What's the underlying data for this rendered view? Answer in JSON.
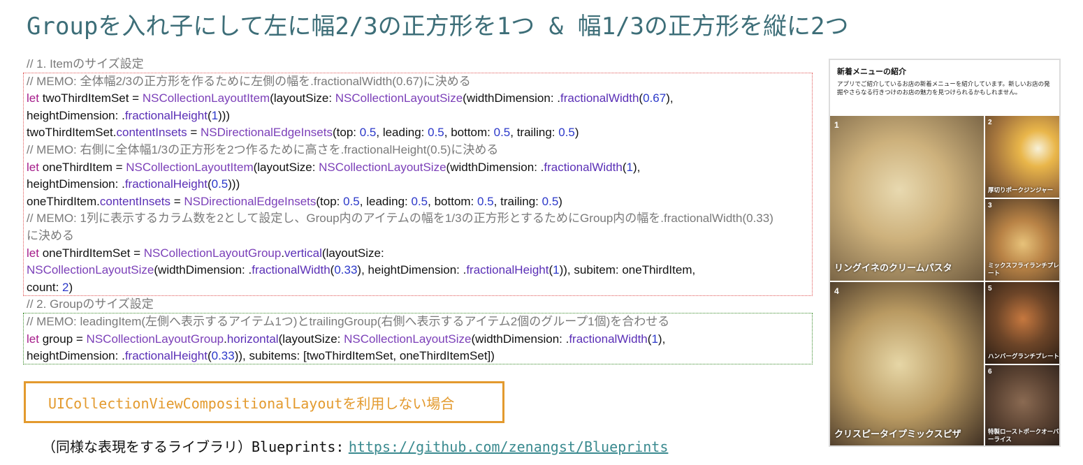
{
  "title": "Groupを入れ子にして左に幅2/3の正方形を1つ & 幅1/3の正方形を縦に2つ",
  "code": {
    "c1": "// 1. Itemのサイズ設定",
    "c2": "// MEMO: 全体幅2/3の正方形を作るために左側の幅を.fractionalWidth(0.67)に決める",
    "l3": {
      "kw": "let",
      "a": " twoThirdItemSet = ",
      "cls1": "NSCollectionLayoutItem",
      "b": "(layoutSize: ",
      "cls2": "NSCollectionLayoutSize",
      "c": "(widthDimension: .",
      "p": "fractionalWidth",
      "d": "(",
      "n": "0.67",
      "e": "),"
    },
    "l4": {
      "a": "heightDimension: .",
      "p": "fractionalHeight",
      "b": "(",
      "n": "1",
      "c": ")))"
    },
    "l5": {
      "a": "twoThirdItemSet.",
      "p1": "contentInsets",
      "b": " = ",
      "cls": "NSDirectionalEdgeInsets",
      "c": "(top: ",
      "n1": "0.5",
      "d": ", leading: ",
      "n2": "0.5",
      "e": ", bottom: ",
      "n3": "0.5",
      "f": ", trailing: ",
      "n4": "0.5",
      "g": ")"
    },
    "c6": "// MEMO: 右側に全体幅1/3の正方形を2つ作るために高さを.fractionalHeight(0.5)に決める",
    "l7": {
      "kw": "let",
      "a": " oneThirdItem = ",
      "cls1": "NSCollectionLayoutItem",
      "b": "(layoutSize: ",
      "cls2": "NSCollectionLayoutSize",
      "c": "(widthDimension: .",
      "p": "fractionalWidth",
      "d": "(",
      "n": "1",
      "e": "),"
    },
    "l8": {
      "a": "heightDimension: .",
      "p": "fractionalHeight",
      "b": "(",
      "n": "0.5",
      "c": ")))"
    },
    "l9": {
      "a": "oneThirdItem.",
      "p1": "contentInsets",
      "b": " = ",
      "cls": "NSDirectionalEdgeInsets",
      "c": "(top: ",
      "n1": "0.5",
      "d": ", leading: ",
      "n2": "0.5",
      "e": ", bottom: ",
      "n3": "0.5",
      "f": ", trailing: ",
      "n4": "0.5",
      "g": ")"
    },
    "c10": "// MEMO: 1列に表示するカラム数を2として設定し、Group内のアイテムの幅を1/3の正方形とするためにGroup内の幅を.fractionalWidth(0.33)",
    "c11": "に決める",
    "l12": {
      "kw": "let",
      "a": " oneThirdItemSet = ",
      "cls": "NSCollectionLayoutGroup",
      "b": ".",
      "p": "vertical",
      "c": "(layoutSize:"
    },
    "l13": {
      "cls": "NSCollectionLayoutSize",
      "a": "(widthDimension: .",
      "p1": "fractionalWidth",
      "b": "(",
      "n1": "0.33",
      "c": "), heightDimension: .",
      "p2": "fractionalHeight",
      "d": "(",
      "n2": "1",
      "e": ")), subitem: oneThirdItem,"
    },
    "l14": {
      "a": "count: ",
      "n": "2",
      "b": ")"
    },
    "c15": "// 2. Groupのサイズ設定",
    "c16": "// MEMO: leadingItem(左側へ表示するアイテム1つ)とtrailingGroup(右側へ表示するアイテム2個のグループ1個)を合わせる",
    "l17": {
      "kw": "let",
      "a": " group = ",
      "cls1": "NSCollectionLayoutGroup",
      "b": ".",
      "p": "horizontal",
      "c": "(layoutSize: ",
      "cls2": "NSCollectionLayoutSize",
      "d": "(widthDimension: .",
      "p2": "fractionalWidth",
      "e": "(",
      "n": "1",
      "f": "),"
    },
    "l18": {
      "a": "heightDimension: .",
      "p": "fractionalHeight",
      "b": "(",
      "n": "0.33",
      "c": ")), subitems: [twoThirdItemSet, oneThirdItemSet])"
    }
  },
  "button_label": "UICollectionViewCompositionalLayoutを利用しない場合",
  "library": {
    "prefix": "（同様な表現をするライブラリ）",
    "name": "Blueprints:",
    "url": "https://github.com/zenangst/Blueprints"
  },
  "phone": {
    "header": "新着メニューの紹介",
    "description": "アプリでご紹介しているお店の新着メニューを紹介しています。新しいお店の発掘やさらなる行きつけのお店の魅力を見つけられるかもしれません。",
    "tiles": [
      {
        "num": "1",
        "caption": "リングイネのクリームパスタ",
        "color": "#b89a72"
      },
      {
        "num": "2",
        "caption": "厚切りポークジンジャー",
        "color": "#c7a36a"
      },
      {
        "num": "3",
        "caption": "ミックスフライランチプレート",
        "color": "#9c7a4f"
      },
      {
        "num": "4",
        "caption": "クリスピータイプミックスピザ",
        "color": "#8f6a46"
      },
      {
        "num": "5",
        "caption": "ハンバーグランチプレート",
        "color": "#6b4a2e"
      },
      {
        "num": "6",
        "caption": "特製ローストポークオーバーライス",
        "color": "#5e4330"
      }
    ]
  }
}
